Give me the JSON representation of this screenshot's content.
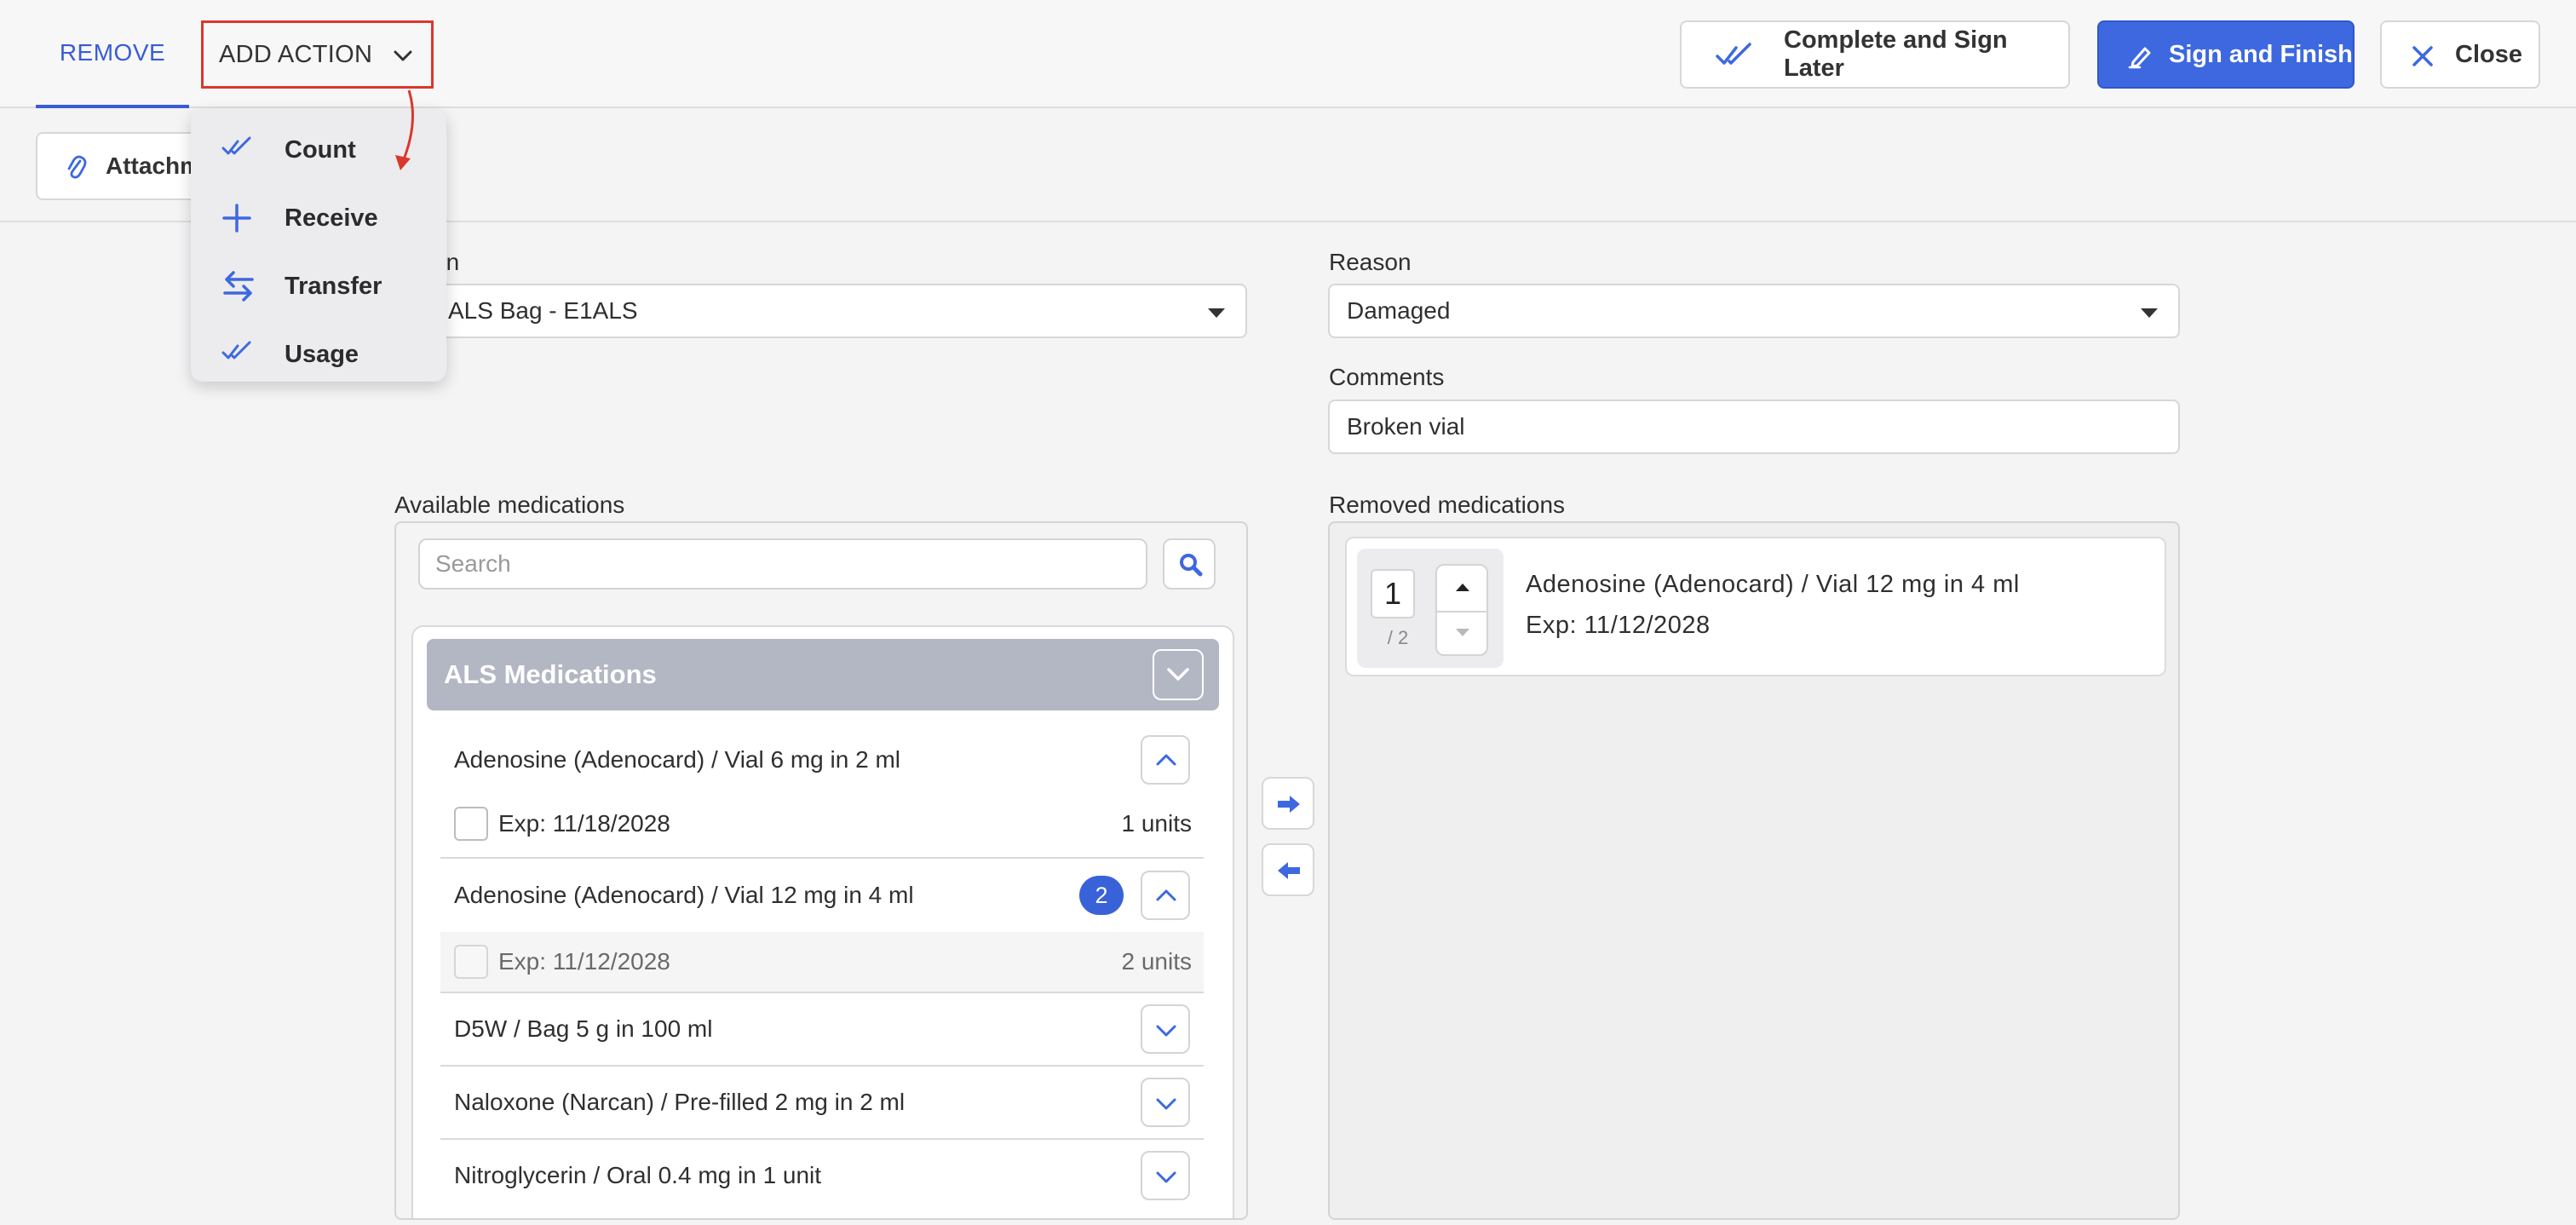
{
  "header": {
    "tab_remove": "REMOVE",
    "add_action": "ADD ACTION",
    "complete_later": "Complete and Sign Later",
    "sign_finish": "Sign and Finish",
    "close": "Close"
  },
  "toolbar": {
    "attachments": "Attachm"
  },
  "add_action_menu": {
    "items": [
      {
        "label": "Count",
        "icon": "double-check-icon"
      },
      {
        "label": "Receive",
        "icon": "plus-icon"
      },
      {
        "label": "Transfer",
        "icon": "transfer-arrows-icon"
      },
      {
        "label": "Usage",
        "icon": "double-check-icon"
      }
    ]
  },
  "form": {
    "location_label": "tion",
    "location_value": "ALS Bag - E1ALS",
    "reason_label": "Reason",
    "reason_value": "Damaged",
    "comments_label": "Comments",
    "comments_value": "Broken vial"
  },
  "available": {
    "label": "Available medications",
    "search_placeholder": "Search",
    "group_name": "ALS Medications",
    "meds": [
      {
        "name": "Adenosine (Adenocard) / Vial 6 mg in 2 ml",
        "expanded": true,
        "lots": [
          {
            "exp": "Exp: 11/18/2028",
            "units": "1 units",
            "disabled": false
          }
        ]
      },
      {
        "name": "Adenosine (Adenocard) / Vial 12 mg in 4 ml",
        "badge": "2",
        "expanded": true,
        "lots": [
          {
            "exp": "Exp: 11/12/2028",
            "units": "2 units",
            "disabled": true
          }
        ]
      },
      {
        "name": "D5W / Bag 5 g in 100 ml",
        "expanded": false
      },
      {
        "name": "Naloxone (Narcan) / Pre-filled 2 mg in 2 ml",
        "expanded": false
      },
      {
        "name": "Nitroglycerin / Oral 0.4 mg in 1 unit",
        "expanded": false
      }
    ]
  },
  "removed": {
    "label": "Removed medications",
    "items": [
      {
        "qty": "1",
        "of": "/ 2",
        "name": "Adenosine (Adenocard) / Vial 12 mg in 4 ml",
        "exp": "Exp: 11/12/2028"
      }
    ]
  },
  "colors": {
    "accent": "#3d68e0",
    "highlight_border": "#d9382e",
    "group_header": "#b3b7c4"
  }
}
